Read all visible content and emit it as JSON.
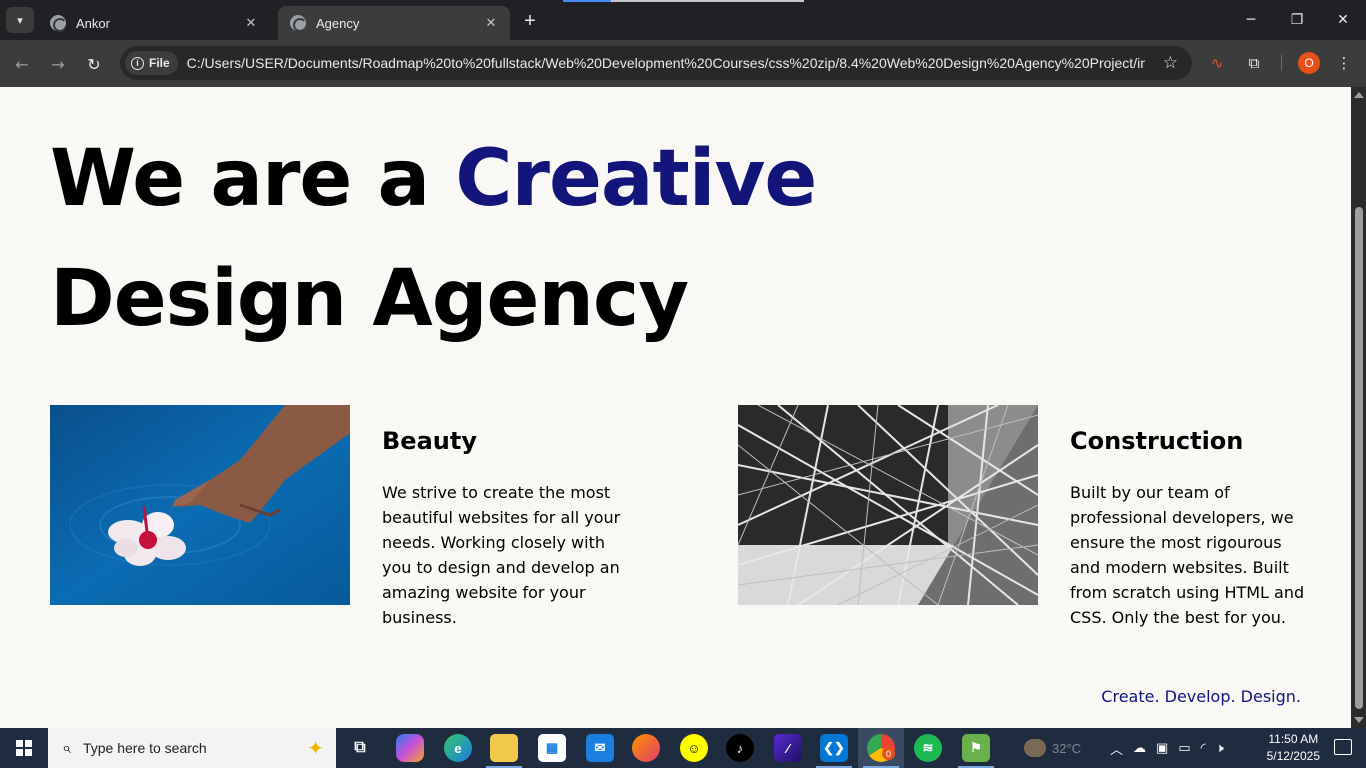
{
  "browser": {
    "tabs": [
      {
        "title": "Ankor",
        "active": false
      },
      {
        "title": "Agency",
        "active": true
      }
    ],
    "site_chip": "File",
    "url": "C:/Users/USER/Documents/Roadmap%20to%20fullstack/Web%20Development%20Courses/css%20zip/8.4%20Web%20Design%20Agency%20Project/ind...",
    "profile_initial": "O",
    "icons": {
      "back": "arrow-left-icon",
      "forward": "arrow-right-icon",
      "reload": "reload-icon",
      "bookmark": "star-icon",
      "extensions": "puzzle-icon",
      "menu": "kebab-menu-icon"
    }
  },
  "page": {
    "hero_line1_prefix": "We are a ",
    "hero_line1_accent": "Creative",
    "hero_line2": "Design Agency",
    "accent_color": "#13157a",
    "features": [
      {
        "title": "Beauty",
        "text": "We strive to create the most beautiful websites for all your needs. Working closely with you to design and develop an amazing website for your business."
      },
      {
        "title": "Construction",
        "text": "Built by our team of professional developers, we ensure the most rigourous and modern websites. Built from scratch using HTML and CSS. Only the best for you."
      }
    ],
    "tagline": "Create. Develop. Design."
  },
  "taskbar": {
    "search_placeholder": "Type here to search",
    "weather": "32°C",
    "time": "11:50 AM",
    "date": "5/12/2025",
    "chrome_badge": "0",
    "apps": [
      "task-view-icon",
      "copilot-icon",
      "edge-icon",
      "file-explorer-icon",
      "store-icon",
      "mail-icon",
      "firefox-icon",
      "snapchat-icon",
      "tiktok-icon",
      "app-icon",
      "vscode-icon",
      "chrome-icon",
      "spotify-icon",
      "game-icon"
    ]
  }
}
